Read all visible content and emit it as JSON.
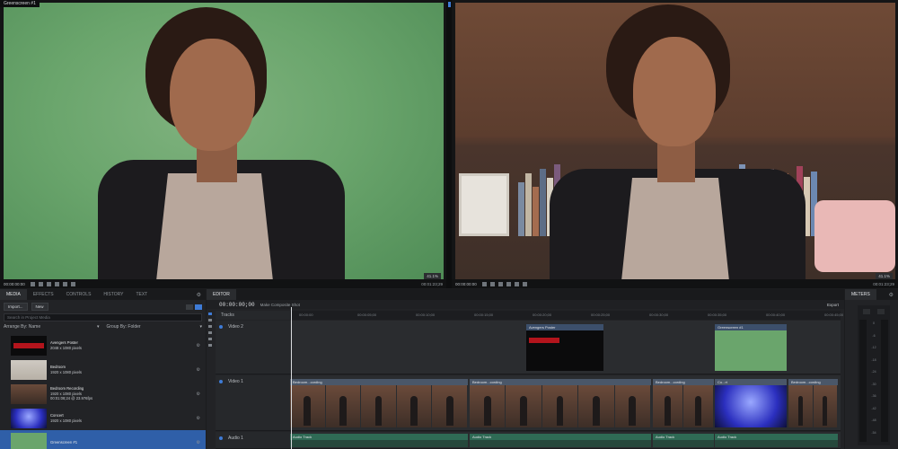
{
  "viewer_left": {
    "label": "Greenscreen #1",
    "timecode": "00:00:00:00",
    "end_timecode": "00:01:23;29",
    "zoom": "41.1%"
  },
  "viewer_right": {
    "timecode": "00:00:00:00",
    "end_timecode": "00:01:23;29",
    "zoom": "41.1%"
  },
  "media_panel": {
    "tabs": [
      "MEDIA",
      "EFFECTS",
      "CONTROLS",
      "HISTORY",
      "TEXT"
    ],
    "import_label": "Import...",
    "new_label": "New",
    "search_placeholder": "Search in Project Media",
    "arrange_label": "Arrange By: Name",
    "group_label": "Group By: Folder",
    "items": [
      {
        "name": "Avengers Poster",
        "info": "2048 x 1080 pixels",
        "kind": "poster",
        "selected": false
      },
      {
        "name": "Bedroom",
        "info": "1920 x 1080 pixels",
        "kind": "bedroom",
        "selected": false
      },
      {
        "name": "Bedroom Recording",
        "info": "1920 x 1080 pixels",
        "info2": "00:01:08;24 @ 23.976fps",
        "kind": "recording",
        "selected": false
      },
      {
        "name": "Concert",
        "info": "1920 x 1080 pixels",
        "kind": "concert",
        "selected": false
      },
      {
        "name": "Greenscreen #1",
        "info": "",
        "kind": "green",
        "selected": true
      }
    ]
  },
  "editor": {
    "tab_label": "EDITOR",
    "timecode": "00:00:00;00",
    "make_composite": "Make Composite Shot",
    "export_label": "Export",
    "tracks_label": "Tracks",
    "ruler_ticks": [
      "00:00:00",
      "00:00:05;00",
      "00:00:10;00",
      "00:00:15;00",
      "00:00:20;00",
      "00:00:25;00",
      "00:00:30;00",
      "00:00:35;00",
      "00:00:40;00",
      "00:00:45;00"
    ],
    "tracks": [
      {
        "name": "Video 2",
        "clips": [
          {
            "label": "Avengers Poster",
            "kind": "poster"
          },
          {
            "label": "Greenscreen #1",
            "kind": "green"
          }
        ]
      },
      {
        "name": "Video 1",
        "clips": [
          {
            "label": "Bedroom...cording",
            "kind": "frames"
          },
          {
            "label": "Bedroom...cording",
            "kind": "frames"
          },
          {
            "label": "Bedroom...cording",
            "kind": "frames"
          },
          {
            "label": "Co...rt",
            "kind": "concert"
          },
          {
            "label": "Bedroom...cording",
            "kind": "frames"
          }
        ]
      },
      {
        "name": "Audio 1",
        "clips": [
          {
            "label": "Audio Track"
          },
          {
            "label": "Audio Track"
          },
          {
            "label": "Audio Track"
          },
          {
            "label": "Audio Track"
          }
        ]
      }
    ]
  },
  "meters": {
    "tab_label": "METERS",
    "scale": [
      "0",
      "-6",
      "-12",
      "-18",
      "-24",
      "-30",
      "-36",
      "-42",
      "-48",
      "-54"
    ]
  },
  "colors": {
    "accent": "#3e7bd6",
    "green_screen": "#6aa56c",
    "video_clip": "#4a5769",
    "audio_clip": "#2f6a55"
  }
}
